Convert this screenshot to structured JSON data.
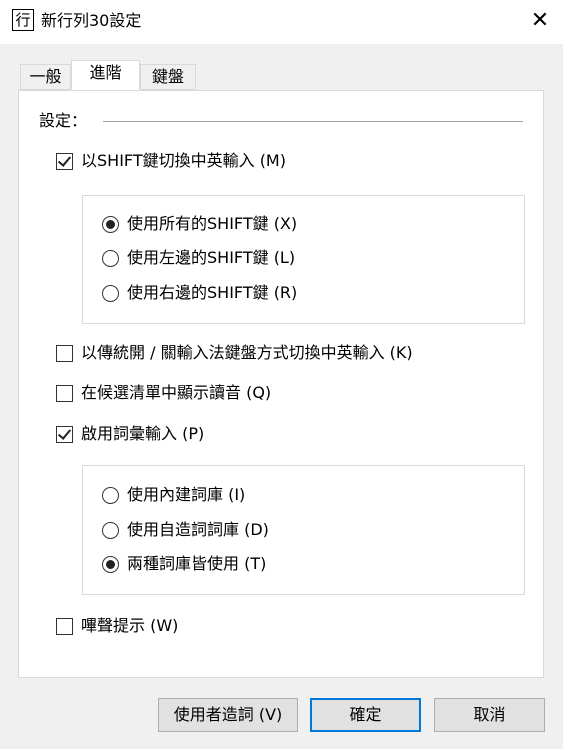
{
  "window": {
    "icon_glyph": "行",
    "title": "新行列30設定",
    "close_glyph": "✕"
  },
  "tabs": [
    {
      "label": "一般",
      "active": false
    },
    {
      "label": "進階",
      "active": true
    },
    {
      "label": "鍵盤",
      "active": false
    }
  ],
  "settings": {
    "section_label": "設定：",
    "shift_toggle": {
      "label": "以SHIFT鍵切換中英輸入 (M)",
      "checked": true
    },
    "shift_options": [
      {
        "label": "使用所有的SHIFT鍵 (X)",
        "selected": true
      },
      {
        "label": "使用左邊的SHIFT鍵 (L)",
        "selected": false
      },
      {
        "label": "使用右邊的SHIFT鍵 (R)",
        "selected": false
      }
    ],
    "ime_toggle": {
      "label": "以傳統開 / 關輸入法鍵盤方式切換中英輸入 (K)",
      "checked": false
    },
    "show_pronunciation": {
      "label": "在候選清單中顯示讀音 (Q)",
      "checked": false
    },
    "phrase_input": {
      "label": "啟用詞彙輸入 (P)",
      "checked": true
    },
    "phrase_options": [
      {
        "label": "使用內建詞庫 (I)",
        "selected": false
      },
      {
        "label": "使用自造詞詞庫 (D)",
        "selected": false
      },
      {
        "label": "兩種詞庫皆使用 (T)",
        "selected": true
      }
    ],
    "beep": {
      "label": "嗶聲提示 (W)",
      "checked": false
    }
  },
  "buttons": {
    "user_phrase": "使用者造詞 (V)",
    "ok": "確定",
    "cancel": "取消"
  }
}
